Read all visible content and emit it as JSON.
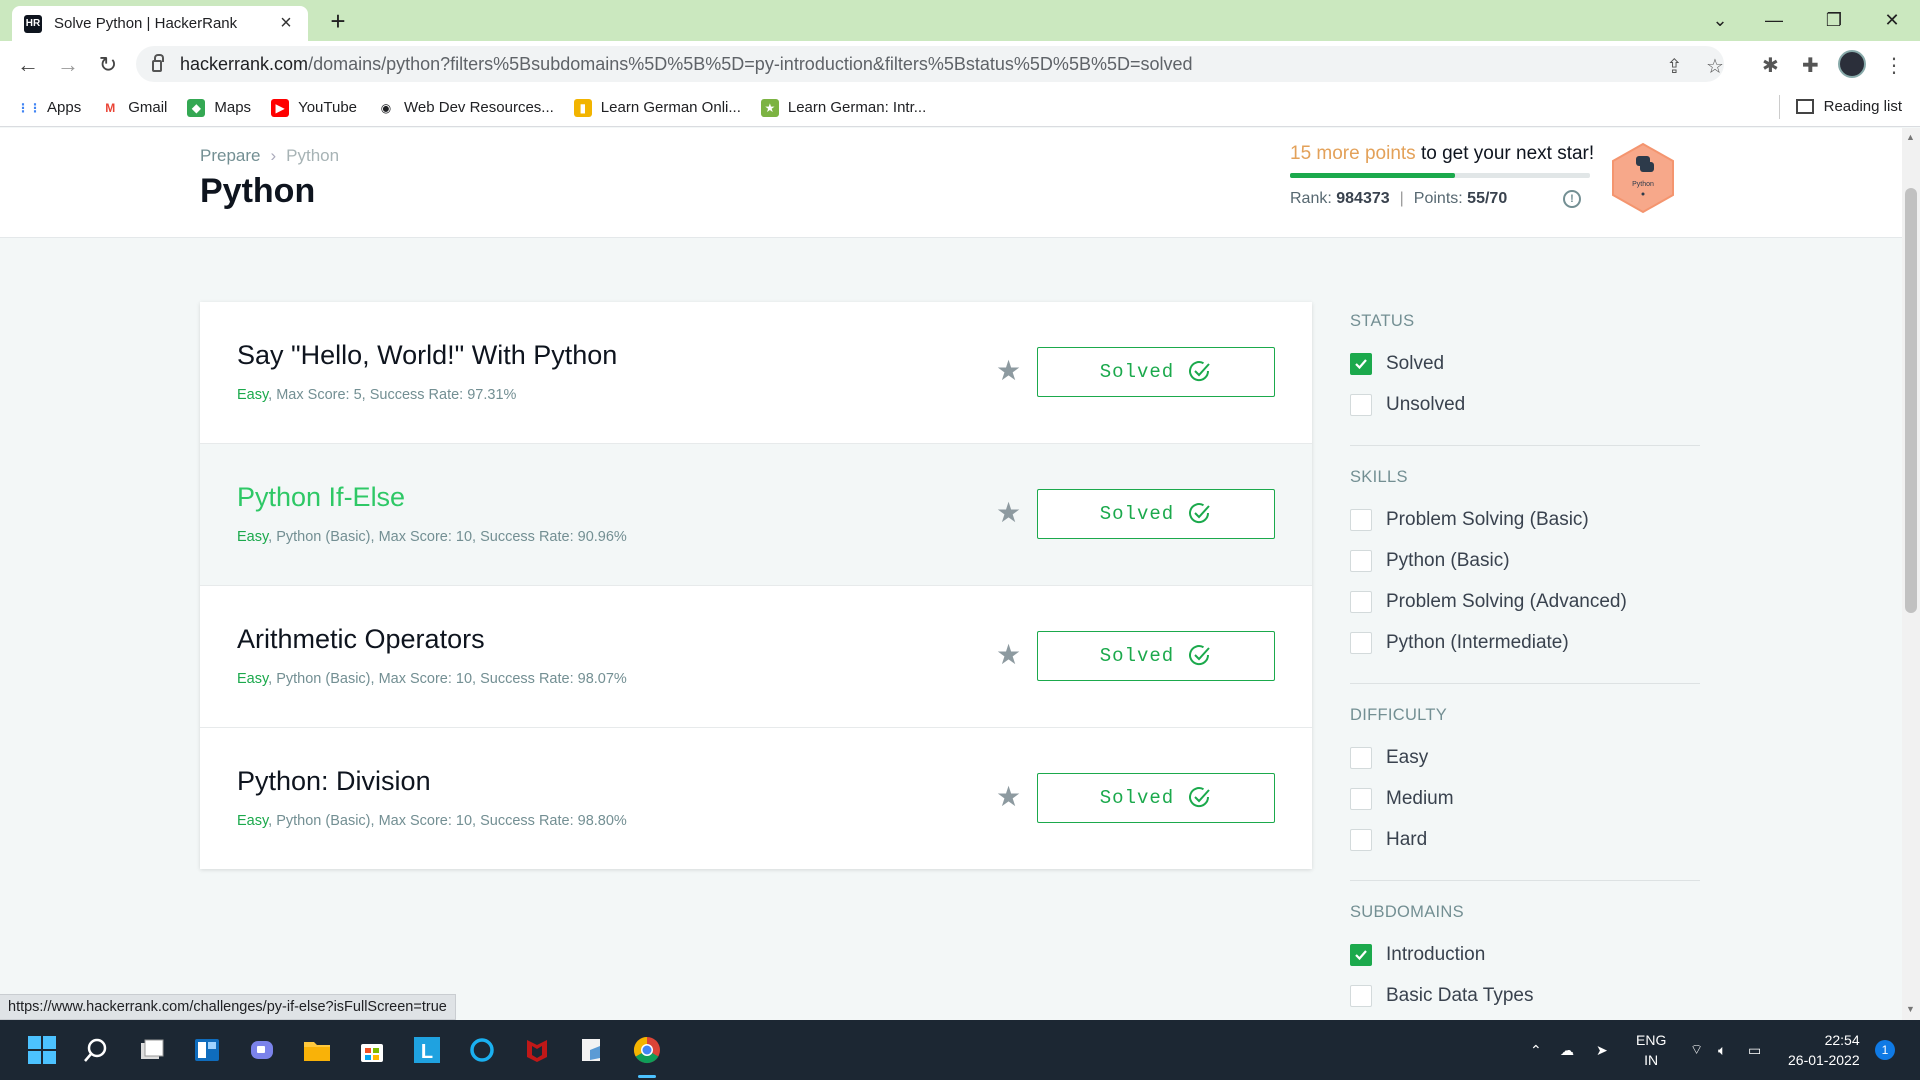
{
  "browser": {
    "tab_title": "Solve Python | HackerRank",
    "tab_favicon": "HR",
    "url_domain": "hackerrank.com",
    "url_rest": "/domains/python?filters%5Bsubdomains%5D%5B%5D=py-introduction&filters%5Bstatus%5D%5B%5D=solved",
    "bookmarks": [
      {
        "label": "Apps",
        "icon": "apps-grid-icon",
        "color": "#4285f4"
      },
      {
        "label": "Gmail",
        "icon": "gmail-icon",
        "color": "#ea4335"
      },
      {
        "label": "Maps",
        "icon": "maps-icon",
        "color": "#34a853"
      },
      {
        "label": "YouTube",
        "icon": "youtube-icon",
        "color": "#ff0000"
      },
      {
        "label": "Web Dev Resources...",
        "icon": "globe-icon",
        "color": "#202124"
      },
      {
        "label": "Learn German Onli...",
        "icon": "german-flag-icon",
        "color": "#f2b400"
      },
      {
        "label": "Learn German: Intr...",
        "icon": "star-bookmark-icon",
        "color": "#7cb342"
      }
    ],
    "reading_list": "Reading list",
    "status_url": "https://www.hackerrank.com/challenges/py-if-else?isFullScreen=true"
  },
  "header": {
    "breadcrumb": [
      "Prepare",
      "Python"
    ],
    "title": "Python",
    "points_highlight": "15 more points",
    "points_rest": " to get your next star!",
    "progress": 0.55,
    "rank_label": "Rank:",
    "rank_value": "984373",
    "points_label": "Points:",
    "points_value": "55/70",
    "badge_label": "Python"
  },
  "challenges": [
    {
      "title": "Say \"Hello, World!\" With Python",
      "difficulty": "Easy",
      "meta": ", Max Score: 5, Success Rate: 97.31%",
      "status": "Solved"
    },
    {
      "title": "Python If-Else",
      "difficulty": "Easy",
      "meta": ", Python (Basic), Max Score: 10, Success Rate: 90.96%",
      "status": "Solved"
    },
    {
      "title": "Arithmetic Operators",
      "difficulty": "Easy",
      "meta": ", Python (Basic), Max Score: 10, Success Rate: 98.07%",
      "status": "Solved"
    },
    {
      "title": "Python: Division",
      "difficulty": "Easy",
      "meta": ", Python (Basic), Max Score: 10, Success Rate: 98.80%",
      "status": "Solved"
    }
  ],
  "filters": {
    "status": {
      "heading": "STATUS",
      "items": [
        {
          "label": "Solved",
          "checked": true
        },
        {
          "label": "Unsolved",
          "checked": false
        }
      ]
    },
    "skills": {
      "heading": "SKILLS",
      "items": [
        {
          "label": "Problem Solving (Basic)",
          "checked": false
        },
        {
          "label": "Python (Basic)",
          "checked": false
        },
        {
          "label": "Problem Solving (Advanced)",
          "checked": false
        },
        {
          "label": "Python (Intermediate)",
          "checked": false
        }
      ]
    },
    "difficulty": {
      "heading": "DIFFICULTY",
      "items": [
        {
          "label": "Easy",
          "checked": false
        },
        {
          "label": "Medium",
          "checked": false
        },
        {
          "label": "Hard",
          "checked": false
        }
      ]
    },
    "subdomains": {
      "heading": "SUBDOMAINS",
      "items": [
        {
          "label": "Introduction",
          "checked": true
        },
        {
          "label": "Basic Data Types",
          "checked": false
        }
      ]
    }
  },
  "taskbar": {
    "lang_top": "ENG",
    "lang_bottom": "IN",
    "time": "22:54",
    "date": "26-01-2022",
    "notifications": "1"
  },
  "colors": {
    "accent": "#1ba94c",
    "highlight": "#e3a159",
    "hover_title": "#2ec866"
  }
}
